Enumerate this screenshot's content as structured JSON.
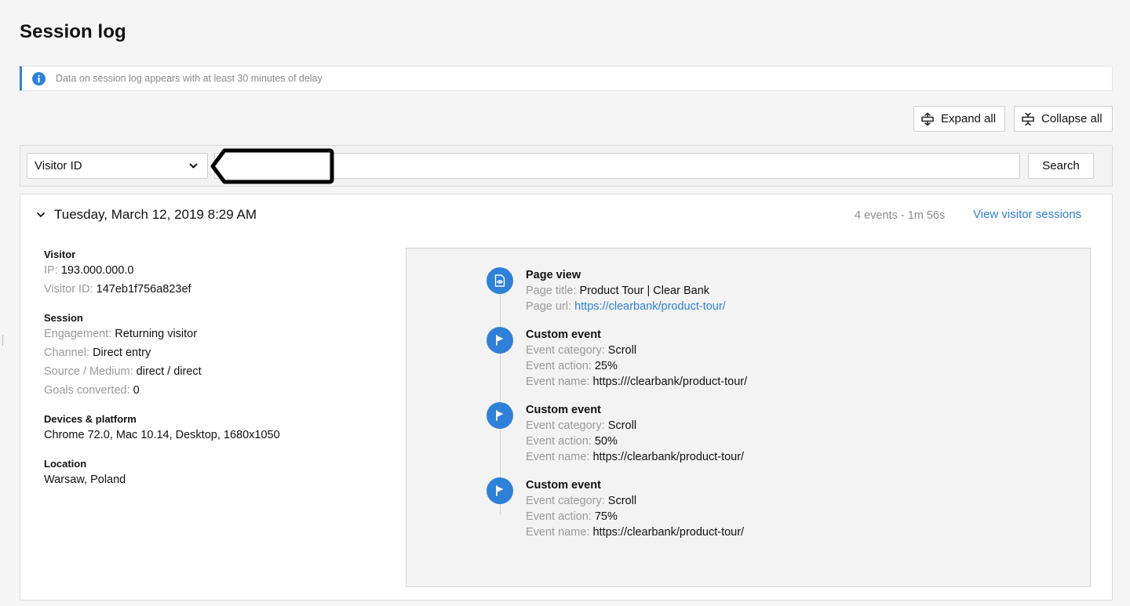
{
  "page": {
    "title": "Session log"
  },
  "notice": {
    "text": "Data on session log appears with at least 30 minutes of delay"
  },
  "toolbar": {
    "expand_label": "Expand all",
    "collapse_label": "Collapse all"
  },
  "search": {
    "selected_field": "Visitor ID",
    "input_value": "",
    "button_label": "Search"
  },
  "session": {
    "date": "Tuesday, March 12, 2019 8:29 AM",
    "summary": "4 events - 1m 56s",
    "view_sessions_label": "View visitor sessions",
    "visitor": {
      "heading": "Visitor",
      "ip_label": "IP:",
      "ip": "193.000.000.0",
      "id_label": "Visitor ID:",
      "id": "147eb1f756a823ef"
    },
    "details": {
      "heading": "Session",
      "engagement_label": "Engagement:",
      "engagement": "Returning visitor",
      "channel_label": "Channel:",
      "channel": "Direct entry",
      "source_label": "Source / Medium:",
      "source": "direct / direct",
      "goals_label": "Goals converted:",
      "goals": "0"
    },
    "devices": {
      "heading": "Devices & platform",
      "value": "Chrome 72.0, Mac 10.14, Desktop, 1680x1050"
    },
    "location": {
      "heading": "Location",
      "value": "Warsaw, Poland"
    }
  },
  "events": [
    {
      "title": "Page view",
      "icon": "page-view-icon",
      "lines": [
        {
          "label": "Page title:",
          "value": "Product Tour | Clear Bank"
        },
        {
          "label": "Page url:",
          "value": "https://clearbank/product-tour/"
        }
      ]
    },
    {
      "title": "Custom event",
      "icon": "flag-icon",
      "lines": [
        {
          "label": "Event category:",
          "value": "Scroll"
        },
        {
          "label": "Event action:",
          "value": "25%"
        },
        {
          "label": "Event name:",
          "value": "https:///clearbank/product-tour/"
        }
      ]
    },
    {
      "title": "Custom event",
      "icon": "flag-icon",
      "lines": [
        {
          "label": "Event category:",
          "value": "Scroll"
        },
        {
          "label": "Event action:",
          "value": "50%"
        },
        {
          "label": "Event name:",
          "value": "https://clearbank/product-tour/"
        }
      ]
    },
    {
      "title": "Custom event",
      "icon": "flag-icon",
      "lines": [
        {
          "label": "Event category:",
          "value": "Scroll"
        },
        {
          "label": "Event action:",
          "value": "75%"
        },
        {
          "label": "Event name:",
          "value": "https://clearbank/product-tour/"
        }
      ]
    }
  ],
  "colors": {
    "accent": "#2f80d8",
    "muted": "#9a9a9a",
    "border": "#dcdcdc"
  }
}
